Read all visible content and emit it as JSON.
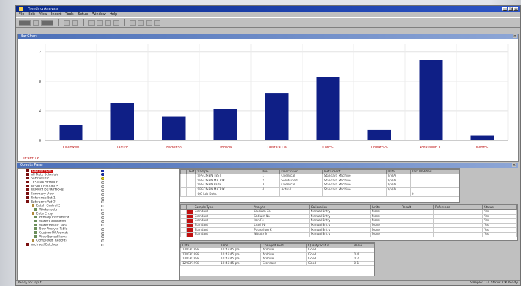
{
  "window": {
    "title": "Trending Analysis"
  },
  "menus": [
    "File",
    "Edit",
    "View",
    "Insert",
    "Tools",
    "Setup",
    "Window",
    "Help"
  ],
  "chart_panel": {
    "title": "Bar Chart",
    "footer": "Current XP"
  },
  "chart_data": {
    "type": "bar",
    "categories": [
      "Cherokee",
      "Tamiro",
      "Hamilton",
      "Dodaba",
      "Calstate Ca",
      "Coro%",
      "Linear%%",
      "Potassium IC",
      "Neon%"
    ],
    "values": [
      2.1,
      5.1,
      3.2,
      4.2,
      6.4,
      8.6,
      1.4,
      10.9,
      0.6
    ],
    "ylim": [
      0,
      13
    ],
    "yticks": [
      "0",
      "4",
      "8",
      "12"
    ],
    "color": "#0f1f86",
    "label_color": "#c02020"
  },
  "objects_panel": {
    "title": "Objects Panel"
  },
  "tree": [
    {
      "label": "Lab Services",
      "highlight": true,
      "status": "blue",
      "icon": "red"
    },
    {
      "label": "All Tests Schedule",
      "status": "blue",
      "icon": "red"
    },
    {
      "label": "Sample Info",
      "status": "yellow",
      "icon": "red"
    },
    {
      "label": "TESTING SERVICE",
      "status": "none",
      "icon": "red"
    },
    {
      "label": "RESULT RECORDS",
      "status": "none",
      "icon": "red"
    },
    {
      "label": "REPORT DEFINITIONS",
      "status": "none",
      "icon": "red"
    },
    {
      "label": "Summary View",
      "status": "none",
      "icon": "red"
    },
    {
      "label": "Reference Set 1",
      "status": "none",
      "icon": "red"
    },
    {
      "label": "Reference Set 2",
      "status": "none",
      "icon": "red"
    },
    {
      "label": "Batch Control 3",
      "status": "none",
      "icon": "folder"
    },
    {
      "label": "Worksheets",
      "status": "none",
      "icon": "doc"
    },
    {
      "label": "Data Entry",
      "status": "none",
      "icon": "folder"
    },
    {
      "label": "Primary Instrument",
      "status": "none",
      "icon": "doc"
    },
    {
      "label": "Water Calibration",
      "status": "none",
      "icon": "doc"
    },
    {
      "label": "Water Result Data",
      "status": "none",
      "icon": "doc"
    },
    {
      "label": "New Analyte Table",
      "status": "none",
      "icon": "doc"
    },
    {
      "label": "Custom Of Aromat",
      "status": "none",
      "icon": "doc"
    },
    {
      "label": "View Sorted Items",
      "status": "none",
      "icon": "doc"
    },
    {
      "label": "Completed_Records",
      "status": "none",
      "icon": "folder"
    },
    {
      "label": "Archived Batches",
      "status": "none",
      "icon": "red"
    }
  ],
  "grid1": {
    "headers": [
      "",
      "Test",
      "Sample",
      "Run",
      "Description",
      "Instrument",
      "Date",
      "Last Modified"
    ],
    "rows": [
      [
        "",
        "",
        "SPECIMEN TEST",
        "1",
        "Chemical",
        "Standard Machine",
        "Y/N/A",
        ""
      ],
      [
        "",
        "",
        "SPECIMEN MATRIX",
        "2",
        "Solubilized",
        "Standard Machine",
        "Y/N/A",
        ""
      ],
      [
        "",
        "",
        "SPECIMEN BASE",
        "3",
        "Chemical",
        "Standard Machine",
        "Y/N/A",
        ""
      ],
      [
        "",
        "",
        "SPECIMEN MATRIX",
        "4",
        "Actual",
        "Standard Machine",
        "Y/N/A",
        ""
      ],
      [
        "",
        "",
        "QC Lab Data",
        "",
        "",
        "",
        "",
        "0"
      ]
    ]
  },
  "grid2": {
    "headers": [
      "",
      "",
      "Sample Type",
      "Analyte",
      "Calibration",
      "Units",
      "Result",
      "Reference",
      "Status"
    ],
    "rows": [
      [
        "",
        "",
        "Standard",
        "Calcium Ca",
        "Manual Entry",
        "None",
        "",
        "",
        "Yes"
      ],
      [
        "",
        "",
        "Standard",
        "Sodium Na",
        "Manual Entry",
        "None",
        "",
        "",
        "Yes"
      ],
      [
        "",
        "",
        "Standard",
        "Iron Fe",
        "Manual Entry",
        "None",
        "",
        "",
        "Yes"
      ],
      [
        "",
        "",
        "Standard",
        "Lead Pb",
        "Manual Entry",
        "None",
        "",
        "",
        "Yes"
      ],
      [
        "",
        "",
        "Standard",
        "Potassium K",
        "Manual Entry",
        "None",
        "",
        "",
        "Yes"
      ],
      [
        "",
        "",
        "Standard",
        "Nitrate N",
        "Manual Entry",
        "None",
        "",
        "",
        "Yes"
      ]
    ]
  },
  "grid3": {
    "headers": [
      "Date",
      "Time",
      "Changed Field",
      "Quality Status",
      "Value"
    ],
    "rows": [
      [
        "12/03/1998",
        "10:46:45 pm",
        "Archive",
        "Good",
        ""
      ],
      [
        "12/03/1998",
        "10:46:45 pm",
        "Archive",
        "Good",
        "0.4"
      ],
      [
        "12/03/1998",
        "10:46:45 pm",
        "Archive",
        "Good",
        "0.2"
      ],
      [
        "12/03/1998",
        "10:46:45 pm",
        "Standard",
        "Good",
        "0.1"
      ]
    ]
  },
  "status": {
    "left": "Ready for Input",
    "right": "Sample: 124   Status: OK   Ready"
  }
}
